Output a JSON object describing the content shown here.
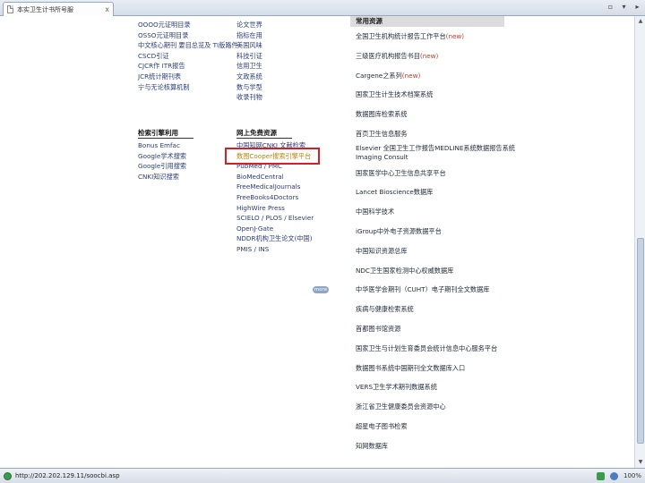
{
  "tab": {
    "title": "本实卫生计书所号服",
    "close": "x"
  },
  "window_controls": [
    "▫",
    "▾",
    "▸"
  ],
  "col1": {
    "items": [
      "OOOO元证明目录",
      "OSSO元证明目录",
      "中文核心期刊 要目总览及 TI版路件",
      "CSCD引证",
      "CJCR作 ITR报告",
      "JCR统计期刊表",
      "宁与无论核算机制"
    ]
  },
  "col2": {
    "items": [
      "论文世界",
      "指标在用",
      "美国风味",
      "科技引证",
      "信用卫生",
      "文政系统",
      "数与学型",
      "收录刊物"
    ]
  },
  "col3": {
    "heading": "检索引擎利用",
    "items": [
      "Bonus Emfac",
      "Google学术搜索",
      "Google引用搜索",
      "CNKI知识搜索"
    ]
  },
  "col4": {
    "heading": "网上免费资源",
    "items": [
      "中国知网CNKI 文献检索",
      "数图Cooper搜索引擎平台",
      "PubMed / PMC",
      "BioMedCentral",
      "FreeMedicalJournals",
      "FreeBooks4Doctors",
      "HighWire Press",
      "SCIELO / PLOS / Elsevier",
      "OpenJ-Gate",
      "NDDR机构卫生论文(中国)",
      "PMIS / INS"
    ]
  },
  "more_button": "more",
  "right": {
    "heading": "常用资源",
    "items": [
      {
        "text": "全国卫生机构统计报告工作平台",
        "badge": "(new)"
      },
      {
        "text": "三级医疗机构报告书目",
        "badge": "(new)"
      },
      {
        "text": "Cargene之系列",
        "badge": "(new)"
      },
      {
        "text": "国家卫生计生技术档案系统",
        "badge": ""
      },
      {
        "text": "数据图库检索系统",
        "badge": ""
      },
      {
        "text": "首页卫生信息服务",
        "badge": ""
      },
      {
        "text": "Elsevier 全国卫生工作报告MEDLINE系统数据报告系统",
        "badge": "",
        "sub": "Imaging Consult"
      },
      {
        "text": "国家医学中心卫生信息共享平台",
        "badge": ""
      },
      {
        "text": "Lancet Bioscience数据库",
        "badge": ""
      },
      {
        "text": "中国科学技术",
        "badge": ""
      },
      {
        "text": "iGroup中外电子资源数据平台",
        "badge": ""
      },
      {
        "text": "中国知识资源总库",
        "badge": ""
      },
      {
        "text": "NDC卫生国家检测中心权威数据库",
        "badge": ""
      },
      {
        "text": "中华医学会期刊（CUHT）电子期刊全文数据库",
        "badge": ""
      },
      {
        "text": "疾病与健康检索系统",
        "badge": ""
      },
      {
        "text": "首都图书馆资源",
        "badge": ""
      },
      {
        "text": "国家卫生与计划生育委员会统计信息中心服务平台",
        "badge": ""
      },
      {
        "text": "数据图书系统中国期刊全文数据库入口",
        "badge": ""
      },
      {
        "text": "VERS卫生学术期刊数据系统",
        "badge": ""
      },
      {
        "text": "浙江省卫生健康委员会资源中心",
        "badge": ""
      },
      {
        "text": "超星电子图书检索",
        "badge": ""
      },
      {
        "text": "知网数据库",
        "badge": ""
      }
    ]
  },
  "status": {
    "url": "http://202.202.129.11/soocbi.asp",
    "zoom": "100%"
  }
}
